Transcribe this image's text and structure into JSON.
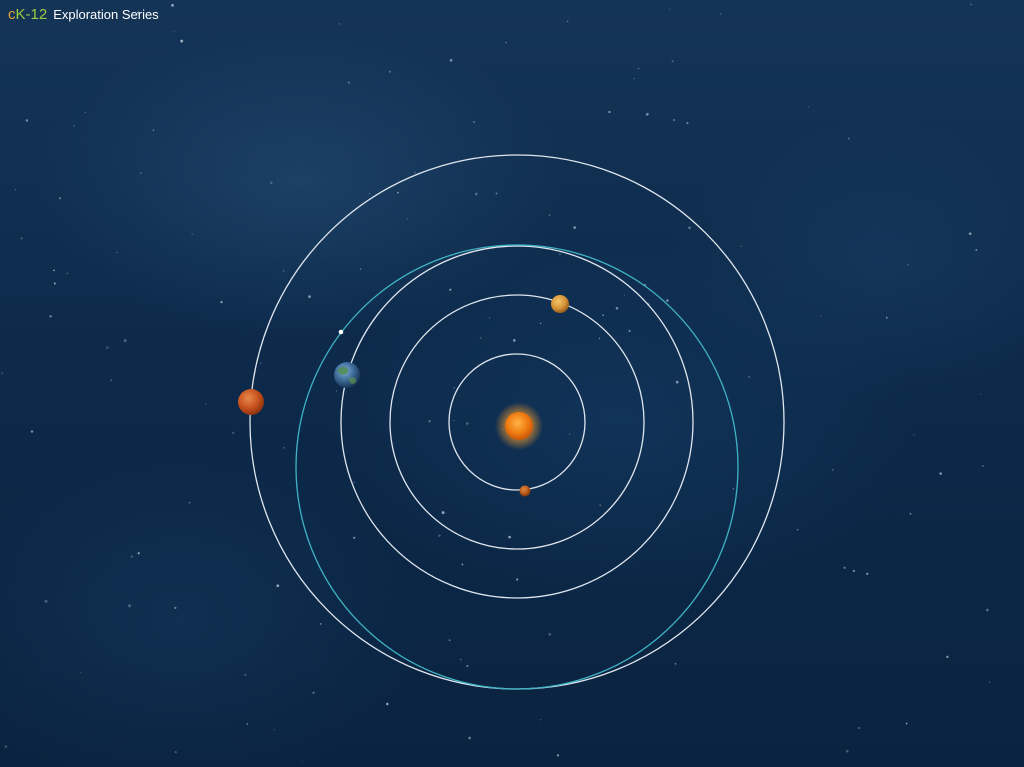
{
  "header": {
    "logo_c": "c",
    "logo_k12": "K-12",
    "series_label": "Exploration Series"
  },
  "colors": {
    "logo_c": "#e8a33b",
    "logo_k12": "#9dcb3c",
    "orbit_circle": "#dfe6ee",
    "orbit_transfer": "#3fb3c4",
    "background": "#0d2a4b"
  },
  "scene": {
    "central_body": "sun",
    "planets": [
      {
        "name": "innermost-planet",
        "color": "#b85a1c"
      },
      {
        "name": "yellow-planet",
        "color": "#d8953a"
      },
      {
        "name": "earth",
        "color": "#3d6b98"
      },
      {
        "name": "red-planet",
        "color": "#c8521f"
      }
    ],
    "spacecraft": "white-dot"
  }
}
